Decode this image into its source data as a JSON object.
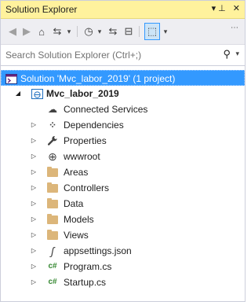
{
  "panel": {
    "title": "Solution Explorer",
    "pin_glyph": "▾ ⊥",
    "close_glyph": "✕"
  },
  "toolbar": {
    "back_glyph": "◀",
    "forward_glyph": "▶",
    "home_glyph": "⌂",
    "switch_views_glyph": "⇆",
    "dropdown_glyph": "▾",
    "pending_changes_glyph": "◷",
    "sync_glyph": "⇆",
    "collapse_all_glyph": "⊟",
    "preview_glyph": "⬚",
    "overflow_glyph": "⋯"
  },
  "search": {
    "placeholder": "Search Solution Explorer (Ctrl+;)",
    "icon_glyph": "⚲",
    "dropdown_glyph": "▾"
  },
  "tree": {
    "solution_label": "Solution 'Mvc_labor_2019' (1 project)",
    "project_label": "Mvc_labor_2019",
    "items": [
      {
        "label": "Connected Services",
        "glyph": "☁"
      },
      {
        "label": "Dependencies",
        "glyph": "⁘"
      },
      {
        "label": "Properties",
        "glyph": "🔧"
      },
      {
        "label": "wwwroot",
        "glyph": "⊕"
      },
      {
        "label": "Areas"
      },
      {
        "label": "Controllers"
      },
      {
        "label": "Data"
      },
      {
        "label": "Models"
      },
      {
        "label": "Views"
      },
      {
        "label": "appsettings.json",
        "glyph": "ʃ"
      },
      {
        "label": "Program.cs",
        "glyph": "c#"
      },
      {
        "label": "Startup.cs",
        "glyph": "c#"
      }
    ],
    "expander_collapsed": "▷",
    "expander_expanded": "◢"
  },
  "colors": {
    "title_bg": "#fff29d",
    "selection": "#3399ff",
    "folder": "#dcb67a",
    "csharp": "#368832"
  }
}
